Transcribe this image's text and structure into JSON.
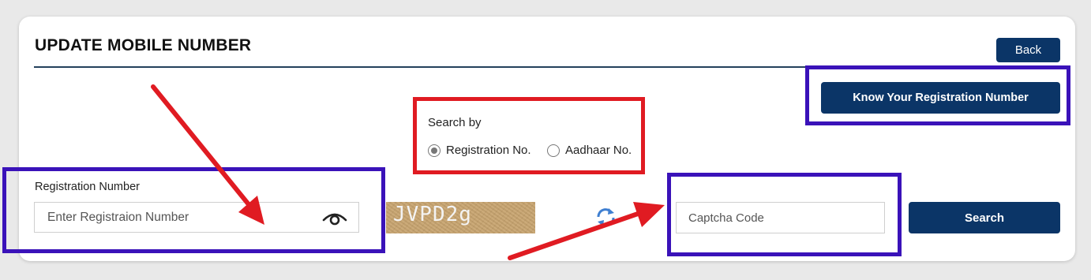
{
  "page": {
    "title": "UPDATE MOBILE NUMBER",
    "back_label": "Back",
    "know_reg_label": "Know Your Registration Number"
  },
  "search_by": {
    "label": "Search by",
    "options": [
      {
        "label": "Registration No.",
        "selected": true
      },
      {
        "label": "Aadhaar No.",
        "selected": false
      }
    ]
  },
  "registration": {
    "label": "Registration Number",
    "placeholder": "Enter Registraion Number",
    "icon": "eye-icon"
  },
  "captcha": {
    "text": "JVPD2g",
    "refresh_icon": "refresh-icon",
    "placeholder": "Captcha Code"
  },
  "search_label": "Search",
  "colors": {
    "primary_button": "#0b3567",
    "annotation_red": "#e01b22",
    "annotation_blue": "#3a12b9"
  }
}
